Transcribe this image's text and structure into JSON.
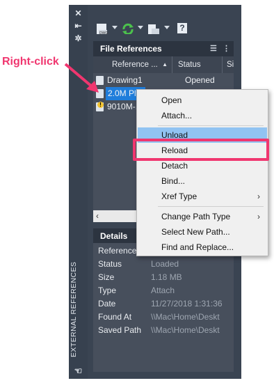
{
  "palette": {
    "strip_title": "EXTERNAL REFERENCES",
    "strip_icons": [
      "close-icon",
      "collapse-icon",
      "settings-icon"
    ]
  },
  "toolbar": {
    "buttons": [
      "attach-dwg-icon",
      "refresh-icon",
      "change-path-icon",
      "help-icon"
    ],
    "help_glyph": "?"
  },
  "file_references": {
    "title": "File References",
    "columns": [
      "Reference ...",
      "Status",
      "Si"
    ],
    "rows": [
      {
        "name": "Drawing1",
        "status": "Opened"
      },
      {
        "name": "2.0M Pl...",
        "status": ""
      },
      {
        "name": "9010M-...",
        "status": ""
      }
    ]
  },
  "details": {
    "title": "Details",
    "rows": [
      {
        "key": "Reference",
        "value": ""
      },
      {
        "key": "Status",
        "value": "Loaded"
      },
      {
        "key": "Size",
        "value": "1.18 MB"
      },
      {
        "key": "Type",
        "value": "Attach"
      },
      {
        "key": "Date",
        "value": "11/27/2018 1:31:36"
      },
      {
        "key": "Found At",
        "value": "\\\\Mac\\Home\\Deskt"
      },
      {
        "key": "Saved Path",
        "value": "\\\\Mac\\Home\\Deskt"
      }
    ]
  },
  "context_menu": {
    "items": [
      "Open",
      "Attach...",
      "Unload",
      "Reload",
      "Detach",
      "Bind...",
      "Xref Type",
      "Change Path Type",
      "Select New Path...",
      "Find and Replace..."
    ],
    "highlighted": "Unload",
    "submenu_arrow": "›"
  },
  "annotation": {
    "callout_text": "Right-click",
    "accent_color": "#f0366f"
  }
}
